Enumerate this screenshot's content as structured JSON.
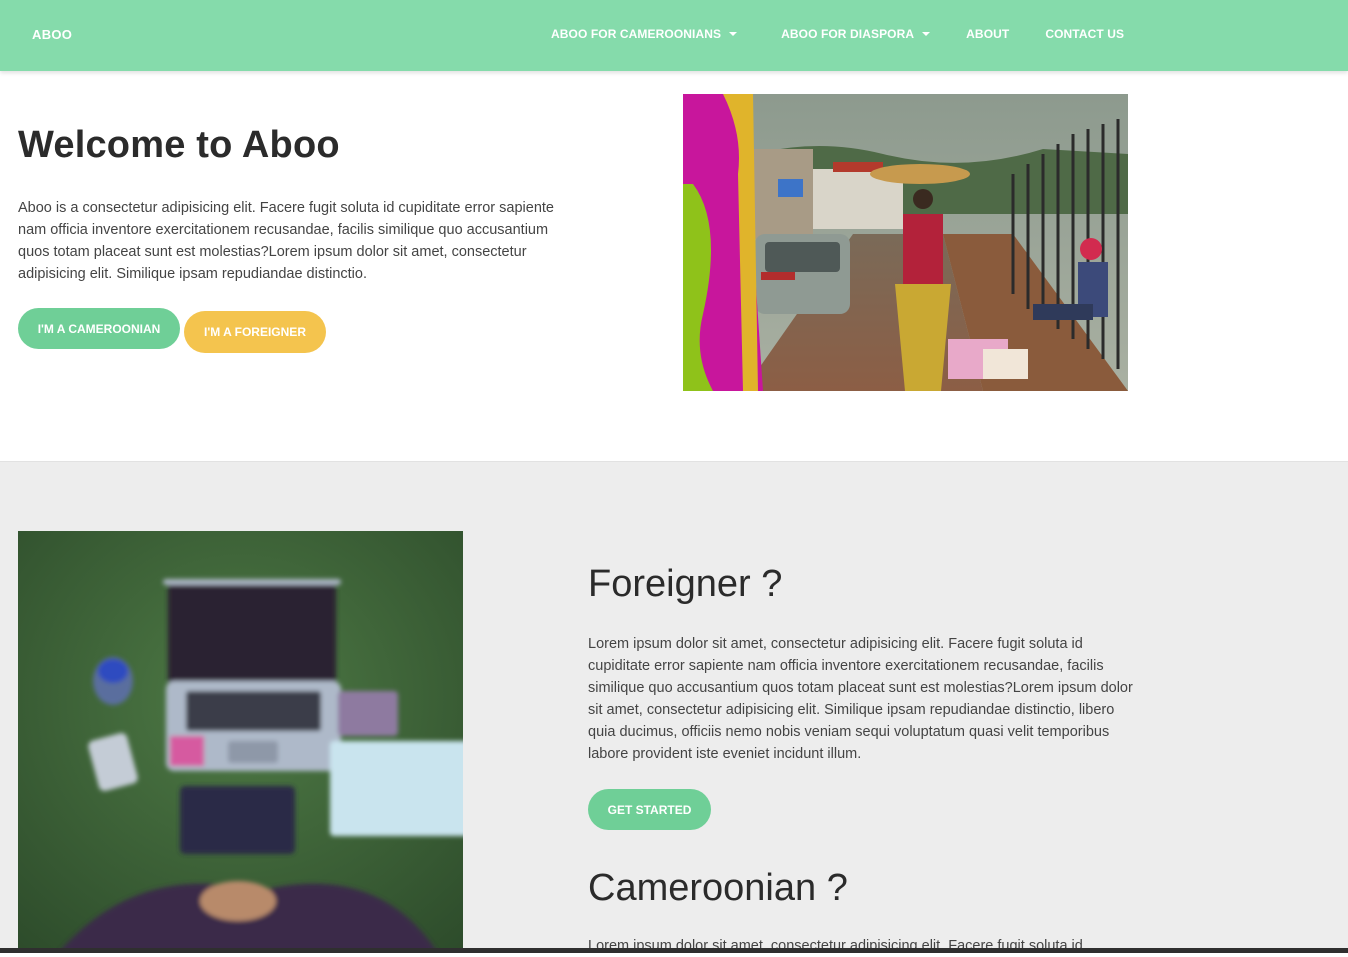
{
  "navbar": {
    "brand": "ABOO",
    "items": [
      {
        "label": "ABOO FOR CAMEROONIANS",
        "dropdown": true
      },
      {
        "label": "ABOO FOR DIASPORA",
        "dropdown": true
      },
      {
        "label": "ABOUT",
        "dropdown": false
      },
      {
        "label": "CONTACT US",
        "dropdown": false
      }
    ]
  },
  "hero": {
    "title": "Welcome to Aboo",
    "text": "Aboo is a consectetur adipisicing elit. Facere fugit soluta id cupiditate error sapiente nam officia inventore exercitationem recusandae, facilis similique quo accusantium quos totam placeat sunt est molestias?Lorem ipsum dolor sit amet, consectetur adipisicing elit. Similique ipsam repudiandae distinctio.",
    "btn_cameroonian": "I'M A CAMEROONIAN",
    "btn_foreigner": "I'M A FOREIGNER"
  },
  "foreigner": {
    "title": "Foreigner ?",
    "text": "Lorem ipsum dolor sit amet, consectetur adipisicing elit. Facere fugit soluta id cupiditate error sapiente nam officia inventore exercitationem recusandae, facilis similique quo accusantium quos totam placeat sunt est molestias?Lorem ipsum dolor sit amet, consectetur adipisicing elit. Similique ipsam repudiandae distinctio, libero quia ducimus, officiis nemo nobis veniam sequi voluptatum quasi velit temporibus labore provident iste eveniet incidunt illum.",
    "btn": "GET STARTED"
  },
  "cameroonian": {
    "title": "Cameroonian ?",
    "text": "Lorem ipsum dolor sit amet, consectetur adipisicing elit. Facere fugit soluta id"
  },
  "colors": {
    "navbar": "#85dbab",
    "primary_button": "#6fcf97",
    "secondary_button": "#f4c44e",
    "section_bg": "#ededed"
  }
}
